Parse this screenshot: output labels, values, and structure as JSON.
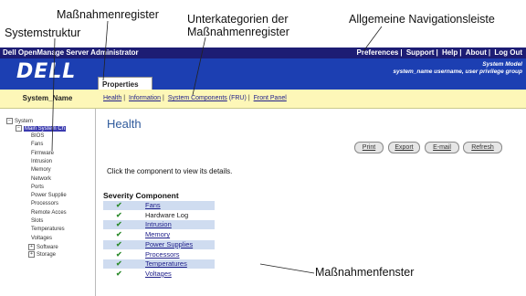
{
  "callouts": {
    "massnahmenregister": "Maßnahmenregister",
    "systemstruktur": "Systemstruktur",
    "unterkategorien_1": "Unterkategorien der",
    "unterkategorien_2": "Maßnahmenregister",
    "navigationsleiste": "Allgemeine Navigationsleiste",
    "massnahmenfenster": "Maßnahmenfenster"
  },
  "topbar": {
    "app_title": "Dell OpenManage Server Administrator",
    "links": [
      "Preferences",
      "Support",
      "Help",
      "About",
      "Log Out"
    ]
  },
  "brand": {
    "logo": "DELL",
    "system_model": "System Model",
    "user_line": "system_name username, user privilege group"
  },
  "left_header": {
    "system_name": "System_Name"
  },
  "tab": {
    "label": "Properties"
  },
  "subnav": {
    "health": "Health",
    "information": "Information",
    "system_components": "System Components",
    "fru": "(FRU)",
    "front_panel": "Front Panel"
  },
  "tree": {
    "system": "System",
    "main_chassis": "Main System Ch",
    "children": [
      "BIOS",
      "Fans",
      "Firmware",
      "Intrusion",
      "Memory",
      "Network",
      "Ports",
      "Power Supplie",
      "Processors",
      "Remote Acces",
      "Slots",
      "Temperatures",
      "Voltages"
    ],
    "software": "Software",
    "storage": "Storage"
  },
  "main": {
    "title": "Health",
    "buttons": {
      "print": "Print",
      "export": "Export",
      "email": "E-mail",
      "refresh": "Refresh"
    },
    "instruction": "Click the component to view its details.",
    "severity_header": "Severity",
    "component_header": "Component",
    "rows": [
      {
        "component": "Fans",
        "link": true
      },
      {
        "component": "Hardware Log",
        "link": false
      },
      {
        "component": "Intrusion",
        "link": true
      },
      {
        "component": "Memory",
        "link": true
      },
      {
        "component": "Power Supplies",
        "link": true
      },
      {
        "component": "Processors",
        "link": true
      },
      {
        "component": "Temperatures",
        "link": true
      },
      {
        "component": "Voltages",
        "link": true
      }
    ],
    "check_glyph": "✔"
  }
}
